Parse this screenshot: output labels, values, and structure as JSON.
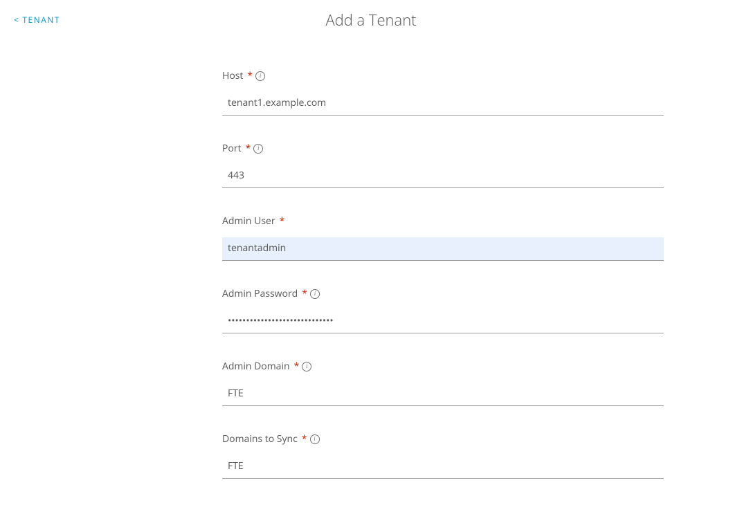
{
  "breadcrumb": {
    "label": "TENANT",
    "chevron": "<"
  },
  "page": {
    "title": "Add a Tenant"
  },
  "form": {
    "host": {
      "label": "Host",
      "value": "tenant1.example.com",
      "required": "*",
      "info": "i"
    },
    "port": {
      "label": "Port",
      "value": "443",
      "required": "*",
      "info": "i"
    },
    "admin_user": {
      "label": "Admin User",
      "value": "tenantadmin",
      "required": "*"
    },
    "admin_password": {
      "label": "Admin Password",
      "value": "•••••••••••••••••••••••••••••",
      "required": "*",
      "info": "i"
    },
    "admin_domain": {
      "label": "Admin Domain",
      "value": "FTE",
      "required": "*",
      "info": "i"
    },
    "domains_to_sync": {
      "label": "Domains to Sync",
      "value": "FTE",
      "required": "*",
      "info": "i"
    }
  }
}
